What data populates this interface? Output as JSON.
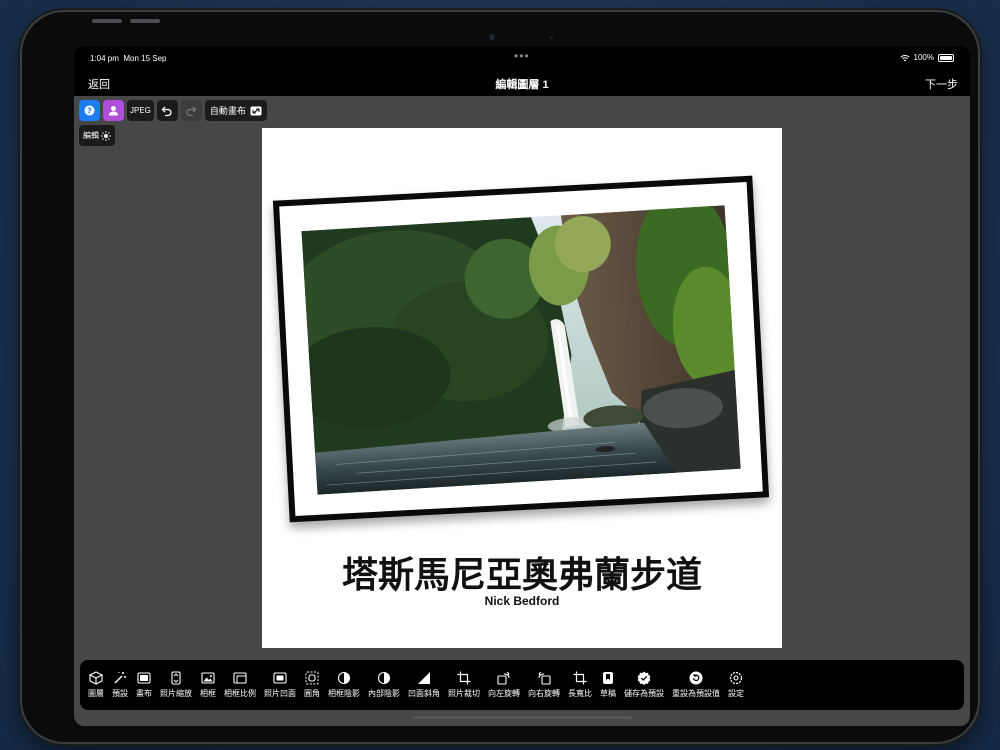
{
  "status": {
    "time": "1:04 pm",
    "date": "Mon 15 Sep",
    "battery": "100%",
    "battery_level": 1.0
  },
  "nav": {
    "back": "返回",
    "title": "編輯圖層 1",
    "next": "下一步"
  },
  "toolbar": {
    "format": "JPEG",
    "auto_canvas": "自動畫布",
    "edit": "編輯"
  },
  "canvas": {
    "title": "塔斯馬尼亞奧弗蘭步道",
    "author": "Nick Bedford"
  },
  "tools": [
    {
      "label": "圖層",
      "icon": "layers-icon"
    },
    {
      "label": "預設",
      "icon": "magic-wand-icon"
    },
    {
      "label": "畫布",
      "icon": "canvas-icon"
    },
    {
      "label": "照片縮放",
      "icon": "photo-scale-icon"
    },
    {
      "label": "相框",
      "icon": "frame-icon"
    },
    {
      "label": "相框比例",
      "icon": "frame-ratio-icon"
    },
    {
      "label": "照片凹面",
      "icon": "photo-inset-icon"
    },
    {
      "label": "圓角",
      "icon": "rounded-corner-icon"
    },
    {
      "label": "相框陰影",
      "icon": "frame-shadow-icon"
    },
    {
      "label": "內部陰影",
      "icon": "inner-shadow-icon"
    },
    {
      "label": "凹面斜角",
      "icon": "bevel-icon"
    },
    {
      "label": "照片裁切",
      "icon": "crop-icon"
    },
    {
      "label": "向左旋轉",
      "icon": "rotate-left-icon"
    },
    {
      "label": "向右旋轉",
      "icon": "rotate-right-icon"
    },
    {
      "label": "長寬比",
      "icon": "aspect-ratio-icon"
    },
    {
      "label": "草稿",
      "icon": "draft-icon"
    },
    {
      "label": "儲存為預設",
      "icon": "save-preset-icon"
    },
    {
      "label": "重設為預設值",
      "icon": "reset-icon"
    },
    {
      "label": "設定",
      "icon": "settings-icon"
    }
  ],
  "colors": {
    "accent_blue": "#1e7cf2",
    "accent_purple": "#b04ed9",
    "workspace": "#474747"
  }
}
